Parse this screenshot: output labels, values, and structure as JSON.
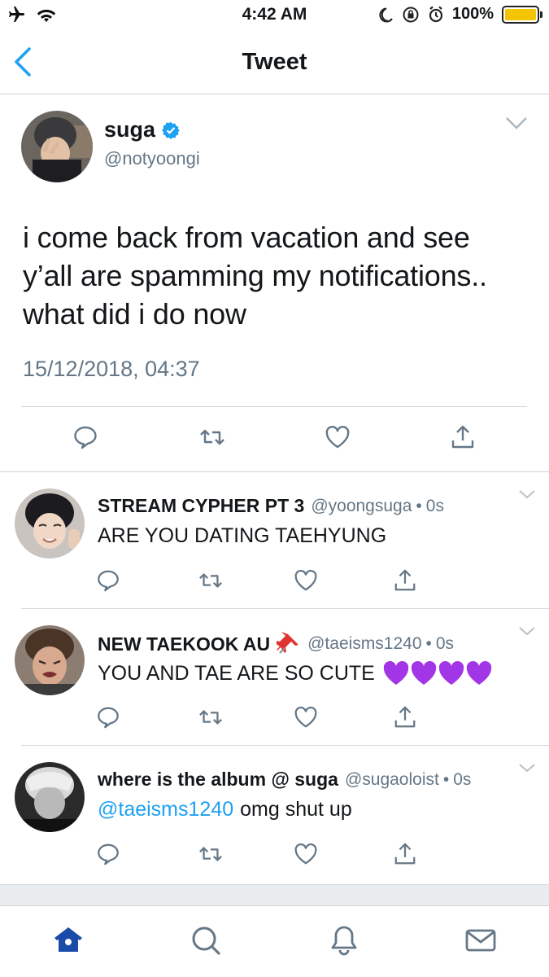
{
  "status_bar": {
    "time": "4:42 AM",
    "battery": "100%"
  },
  "nav": {
    "title": "Tweet"
  },
  "main_tweet": {
    "name": "suga",
    "handle": "@notyoongi",
    "text": "i come back from vacation and see y’all are spamming my notifications.. what did i do now",
    "timestamp": "15/12/2018, 04:37"
  },
  "replies": [
    {
      "name": "STREAM CYPHER PT 3",
      "handle": "@yoongsuga",
      "dot": "•",
      "time": "0s",
      "mention": "",
      "text": "ARE YOU DATING TAEHYUNG"
    },
    {
      "name": "NEW TAEKOOK AU",
      "handle": "@taeisms1240",
      "dot": "•",
      "time": "0s",
      "mention": "",
      "text": "YOU AND TAE ARE SO CUTE"
    },
    {
      "name": "where is the album @ suga",
      "handle": "@sugaoloist",
      "dot": "•",
      "time": "0s",
      "mention": "@taeisms1240",
      "text": "omg shut up"
    }
  ],
  "colors": {
    "accent": "#1da1f2",
    "muted": "#657786",
    "battery": "#f5c400",
    "tab_active": "#1a4ba8",
    "purple_heart": "#a236e6"
  },
  "icons": {
    "status": [
      "airplane-icon",
      "wifi-icon",
      "moon-icon",
      "rotation-lock-icon",
      "alarm-icon",
      "battery-icon"
    ],
    "actions": [
      "reply-icon",
      "retweet-icon",
      "like-icon",
      "share-icon"
    ],
    "tabs": [
      "home-icon",
      "search-icon",
      "notifications-icon",
      "messages-icon"
    ]
  }
}
